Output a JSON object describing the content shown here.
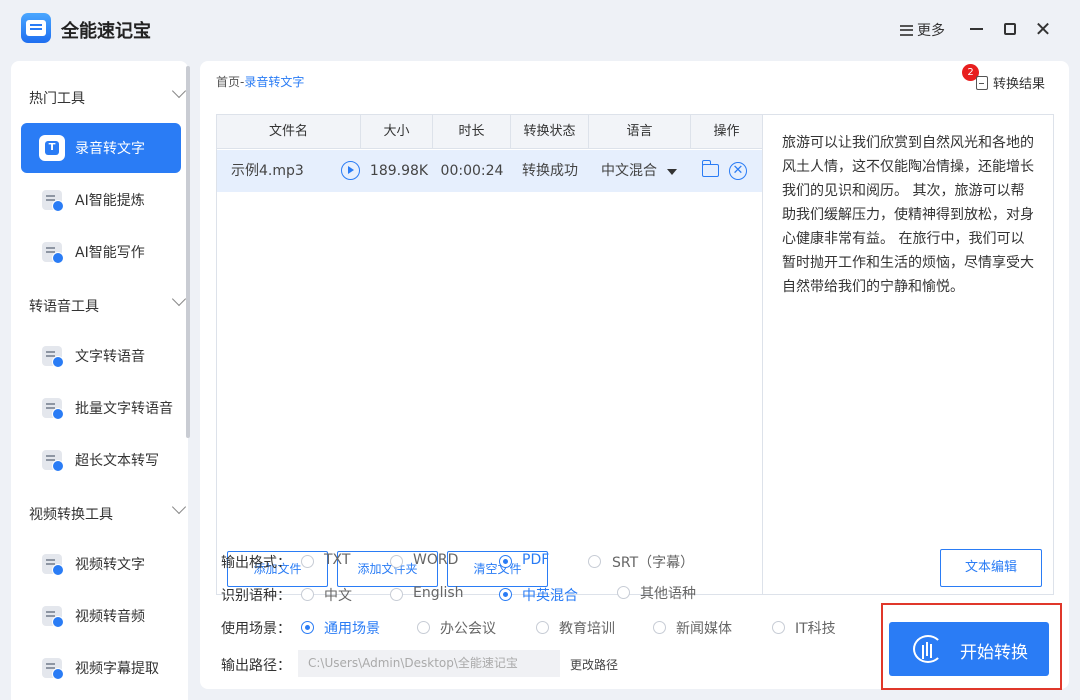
{
  "app": {
    "title": "全能速记宝",
    "more_label": "更多"
  },
  "sidebar": {
    "sections": [
      {
        "label": "热门工具"
      },
      {
        "label": "转语音工具"
      },
      {
        "label": "视频转换工具"
      }
    ],
    "items": [
      {
        "label": "录音转文字",
        "icon": "transcribe-icon"
      },
      {
        "label": "AI智能提炼",
        "icon": "ai-extract-icon"
      },
      {
        "label": "AI智能写作",
        "icon": "ai-write-icon"
      },
      {
        "label": "文字转语音",
        "icon": "tts-icon"
      },
      {
        "label": "批量文字转语音",
        "icon": "batch-tts-icon"
      },
      {
        "label": "超长文本转写",
        "icon": "long-text-icon"
      },
      {
        "label": "视频转文字",
        "icon": "video-text-icon"
      },
      {
        "label": "视频转音频",
        "icon": "video-audio-icon"
      },
      {
        "label": "视频字幕提取",
        "icon": "subtitle-icon"
      }
    ]
  },
  "breadcrumb": {
    "home": "首页",
    "separator": "-",
    "current": "录音转文字"
  },
  "results": {
    "label": "转换结果",
    "badge": "2"
  },
  "table": {
    "columns": [
      "文件名",
      "大小",
      "时长",
      "转换状态",
      "语言",
      "操作"
    ],
    "rows": [
      {
        "name": "示例4.mp3",
        "size": "189.98K",
        "duration": "00:00:24",
        "status": "转换成功",
        "language": "中文混合"
      }
    ]
  },
  "buttons": {
    "add_file": "添加文件",
    "add_folder": "添加文件夹",
    "clear_files": "清空文件",
    "text_edit": "文本编辑",
    "start": "开始转换",
    "change_path": "更改路径"
  },
  "transcript": "旅游可以让我们欣赏到自然风光和各地的风土人情，这不仅能陶冶情操，还能增长我们的见识和阅历。 其次，旅游可以帮助我们缓解压力，使精神得到放松，对身心健康非常有益。 在旅行中，我们可以暂时抛开工作和生活的烦恼，尽情享受大自然带给我们的宁静和愉悦。",
  "options": {
    "format": {
      "label": "输出格式：",
      "choices": [
        "TXT",
        "WORD",
        "PDF",
        "SRT（字幕）"
      ],
      "selected": "PDF"
    },
    "language": {
      "label": "识别语种：",
      "choices": [
        "中文",
        "English",
        "中英混合",
        "其他语种"
      ],
      "selected": "中英混合"
    },
    "scene": {
      "label": "使用场景：",
      "choices": [
        "通用场景",
        "办公会议",
        "教育培训",
        "新闻媒体",
        "IT科技"
      ],
      "selected": "通用场景"
    },
    "path": {
      "label": "输出路径：",
      "value": "C:\\Users\\Admin\\Desktop\\全能速记宝"
    }
  },
  "colors": {
    "accent": "#2a7cf5",
    "highlight_frame": "#e0372a",
    "badge": "#e81e1e"
  }
}
